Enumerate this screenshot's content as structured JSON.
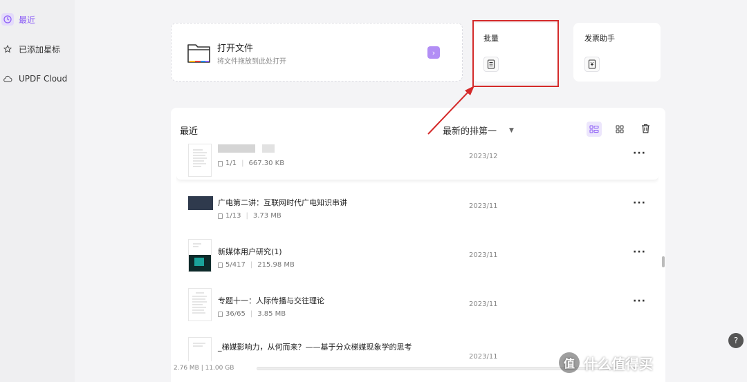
{
  "sidebar": {
    "items": [
      {
        "label": "最近",
        "icon": "clock-icon",
        "active": true
      },
      {
        "label": "已添加星标",
        "icon": "star-icon",
        "active": false
      },
      {
        "label": "UPDF Cloud",
        "icon": "cloud-icon",
        "active": false
      }
    ]
  },
  "open_file": {
    "title": "打开文件",
    "subtitle": "将文件拖放到此处打开",
    "icon": "folder-icon"
  },
  "features": [
    {
      "label": "批量",
      "icon": "batch-document-icon",
      "highlighted": true
    },
    {
      "label": "发票助手",
      "icon": "invoice-icon",
      "highlighted": false
    }
  ],
  "recent": {
    "title": "最近",
    "sort_label": "最新的排第一",
    "files": [
      {
        "name": "",
        "pages": "1/1",
        "size": "667.30 KB",
        "date": "2023/12",
        "blurred": true
      },
      {
        "name": "广电第二讲：互联网时代广电知识串讲",
        "pages": "1/13",
        "size": "3.73 MB",
        "date": "2023/11"
      },
      {
        "name": "新媒体用户研究(1)",
        "pages": "5/417",
        "size": "215.98 MB",
        "date": "2023/11"
      },
      {
        "name": "专题十一：人际传播与交往理论",
        "pages": "36/65",
        "size": "3.85 MB",
        "date": "2023/11"
      },
      {
        "name": "_梯媒影响力，从何而来？——基于分众梯媒现象学的思考",
        "pages": "",
        "size": "",
        "date": "2023/11"
      }
    ]
  },
  "footer": {
    "storage": "2.76 MB | 11.00 GB",
    "storage_used_fraction": 0.0003
  },
  "help_label": "?",
  "watermark": {
    "badge": "值",
    "text": "什么值得买"
  },
  "colors": {
    "accent": "#8b5cf6",
    "highlight_box": "#d42a2a"
  }
}
